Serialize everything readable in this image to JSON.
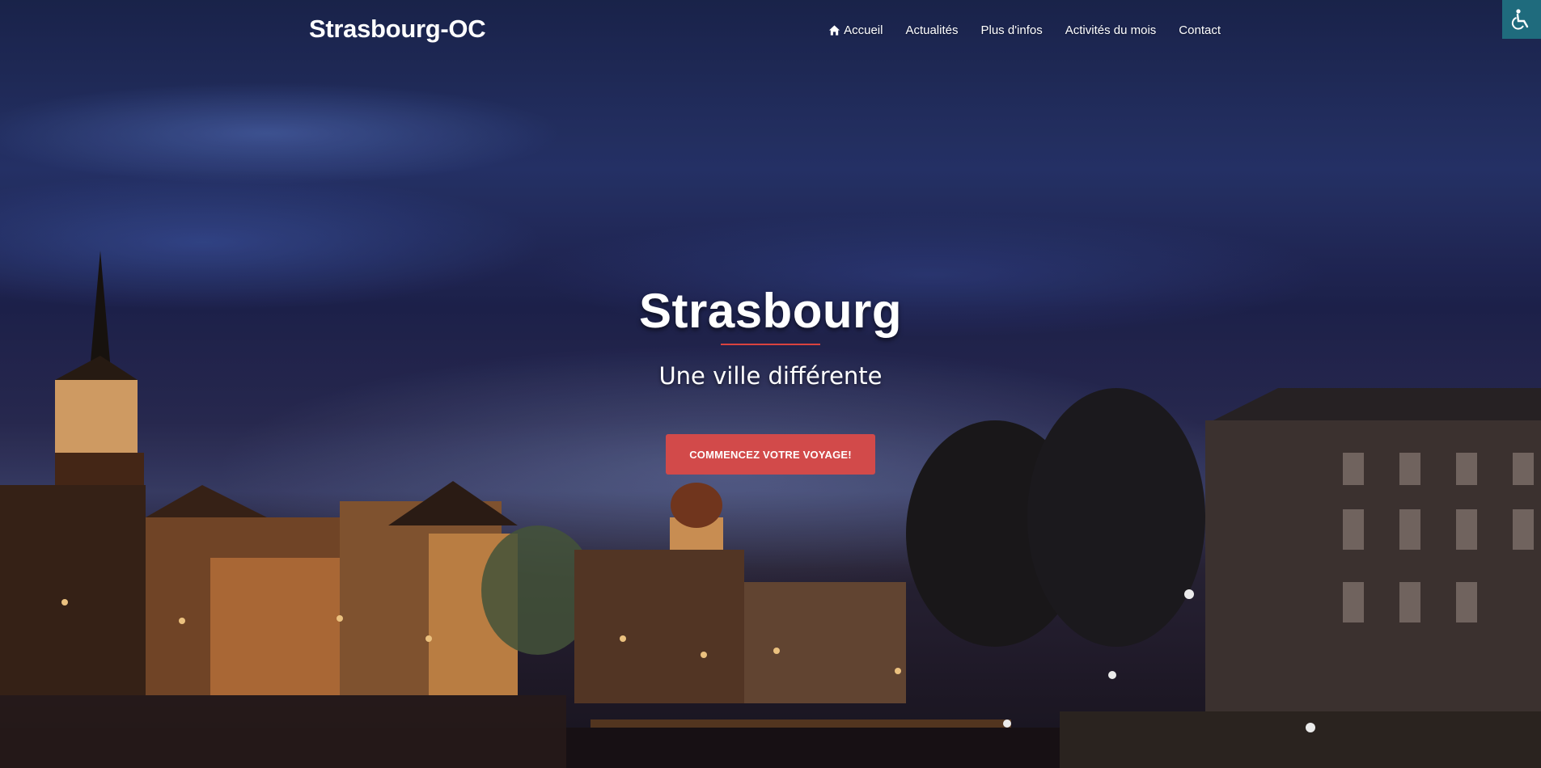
{
  "header": {
    "brand": "Strasbourg-OC",
    "nav": [
      {
        "label": "Accueil",
        "icon": "home-icon"
      },
      {
        "label": "Actualités"
      },
      {
        "label": "Plus d'infos"
      },
      {
        "label": "Activités du mois"
      },
      {
        "label": "Contact"
      }
    ]
  },
  "accessibility": {
    "icon": "wheelchair-icon"
  },
  "hero": {
    "title": "Strasbourg",
    "subtitle": "Une ville différente",
    "cta_label": "COMMENCEZ VOTRE VOYAGE!"
  },
  "colors": {
    "accent": "#d24a4a",
    "accessibility_bg": "#1f6b7d"
  }
}
